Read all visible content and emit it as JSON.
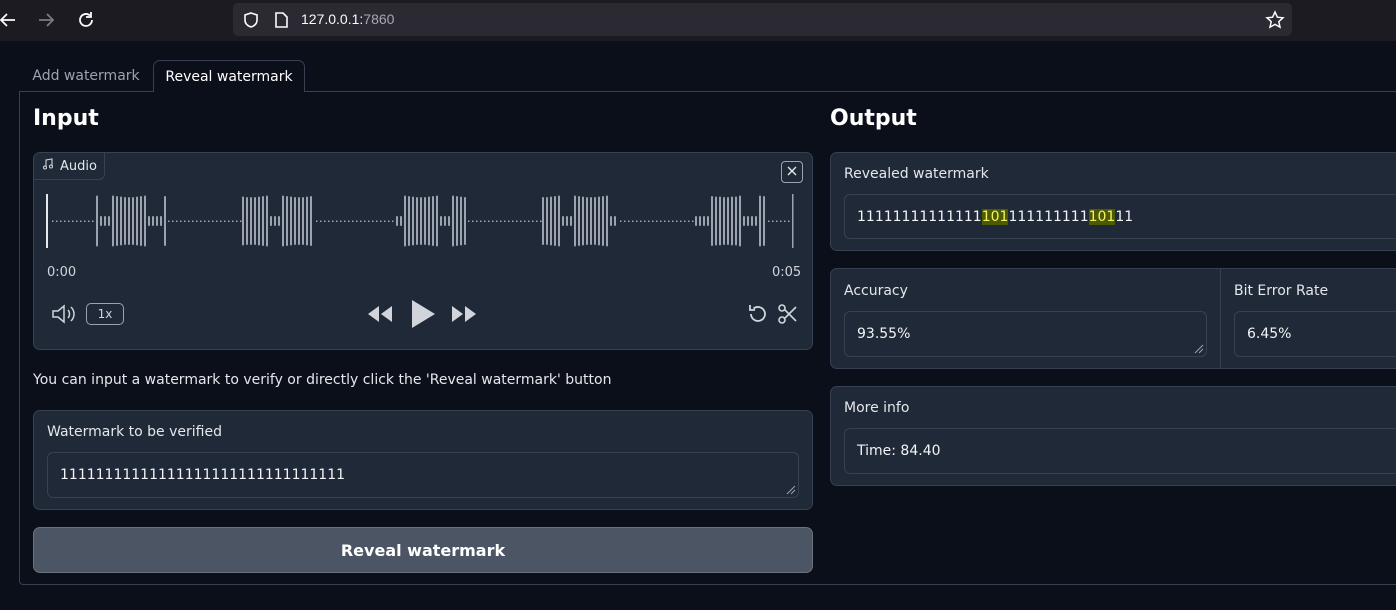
{
  "browser": {
    "url_host": "127.0.0.1:",
    "url_port": "7860"
  },
  "tabs": [
    {
      "label": "Add watermark",
      "active": false
    },
    {
      "label": "Reveal watermark",
      "active": true
    }
  ],
  "input": {
    "heading": "Input",
    "audio": {
      "badge_label": "Audio",
      "time_start": "0:00",
      "time_end": "0:05",
      "speed": "1x"
    },
    "hint": "You can input a watermark to verify or directly click the 'Reveal watermark' button",
    "verify": {
      "label": "Watermark to be verified",
      "value": "11111111111111111111111111111111"
    },
    "reveal_button": "Reveal watermark"
  },
  "output": {
    "heading": "Output",
    "revealed": {
      "label": "Revealed watermark",
      "segments": [
        {
          "text": "11111111111111",
          "highlight": false
        },
        {
          "text": "101",
          "highlight": true
        },
        {
          "text": "111111111",
          "highlight": false
        },
        {
          "text": "101",
          "highlight": true
        },
        {
          "text": "11",
          "highlight": false
        }
      ]
    },
    "accuracy": {
      "label": "Accuracy",
      "value": "93.55%"
    },
    "ber": {
      "label": "Bit Error Rate",
      "value": "6.45%"
    },
    "more_info": {
      "label": "More info",
      "value": "Time: 84.40"
    }
  },
  "colors": {
    "background": "#0b0f19",
    "block": "#1f2937",
    "border": "#374151",
    "highlight_bg": "#4d5a00",
    "highlight_fg": "#f3f36a"
  }
}
